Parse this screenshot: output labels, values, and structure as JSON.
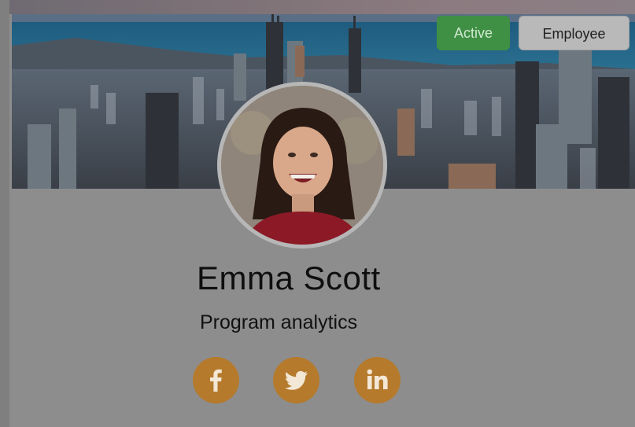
{
  "profile": {
    "name": "Emma Scott",
    "title": "Program analytics",
    "status_badge": "Active",
    "role_badge": "Employee"
  },
  "social": [
    {
      "network": "facebook",
      "icon": "facebook-icon"
    },
    {
      "network": "twitter",
      "icon": "twitter-icon"
    },
    {
      "network": "linkedin",
      "icon": "linkedin-icon"
    }
  ],
  "colors": {
    "active_badge": "#3f8f44",
    "role_badge": "#b9b9b9",
    "social_button": "#b57a2c",
    "overlay_background": "#8d8d8d"
  }
}
